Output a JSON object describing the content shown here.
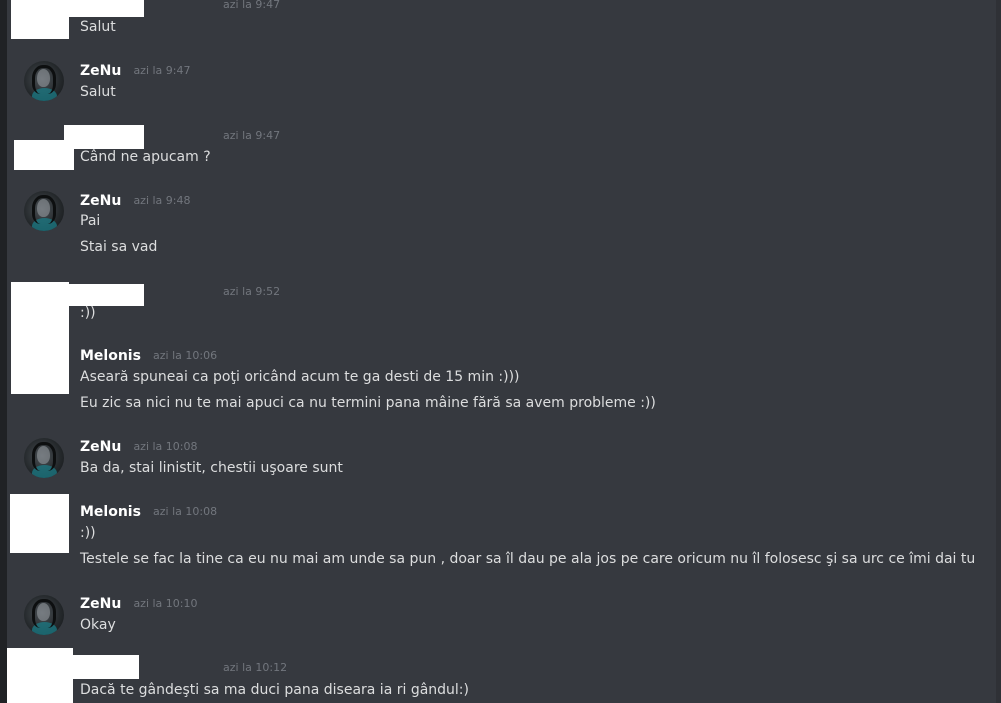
{
  "chat": {
    "messages": [
      {
        "author": "",
        "timestamp": "azi la 9:47",
        "lines": [
          "Salut"
        ]
      },
      {
        "author": "ZeNu",
        "timestamp": "azi la 9:47",
        "lines": [
          "Salut"
        ]
      },
      {
        "author": "",
        "timestamp": "azi la 9:47",
        "lines": [
          "Când ne apucam ?"
        ]
      },
      {
        "author": "ZeNu",
        "timestamp": "azi la 9:48",
        "lines": [
          "Pai",
          "Stai sa vad"
        ]
      },
      {
        "author": "",
        "timestamp": "azi la 9:52",
        "lines": [
          ":))"
        ]
      },
      {
        "author": "Melonis",
        "timestamp": "azi la 10:06",
        "lines": [
          "Aseară spuneai ca poţi oricând acum te  ga desti de 15 min :)))",
          "Eu zic sa nici nu te mai apuci ca nu termini pana mâine fără sa avem probleme :))"
        ]
      },
      {
        "author": "ZeNu",
        "timestamp": "azi la 10:08",
        "lines": [
          "Ba da, stai linistit, chestii uşoare sunt"
        ]
      },
      {
        "author": "Melonis",
        "timestamp": "azi la 10:08",
        "lines": [
          ":))",
          "Testele se fac la tine ca eu nu mai am unde sa pun , doar sa îl dau pe ala jos pe care oricum nu îl folosesc şi sa urc ce îmi dai tu"
        ]
      },
      {
        "author": "ZeNu",
        "timestamp": "azi la 10:10",
        "lines": [
          "Okay"
        ]
      },
      {
        "author": "",
        "timestamp": "azi la 10:12",
        "lines": [
          "Dacă te gândeşti sa ma duci pana diseara ia ri gândul:)"
        ]
      }
    ]
  }
}
